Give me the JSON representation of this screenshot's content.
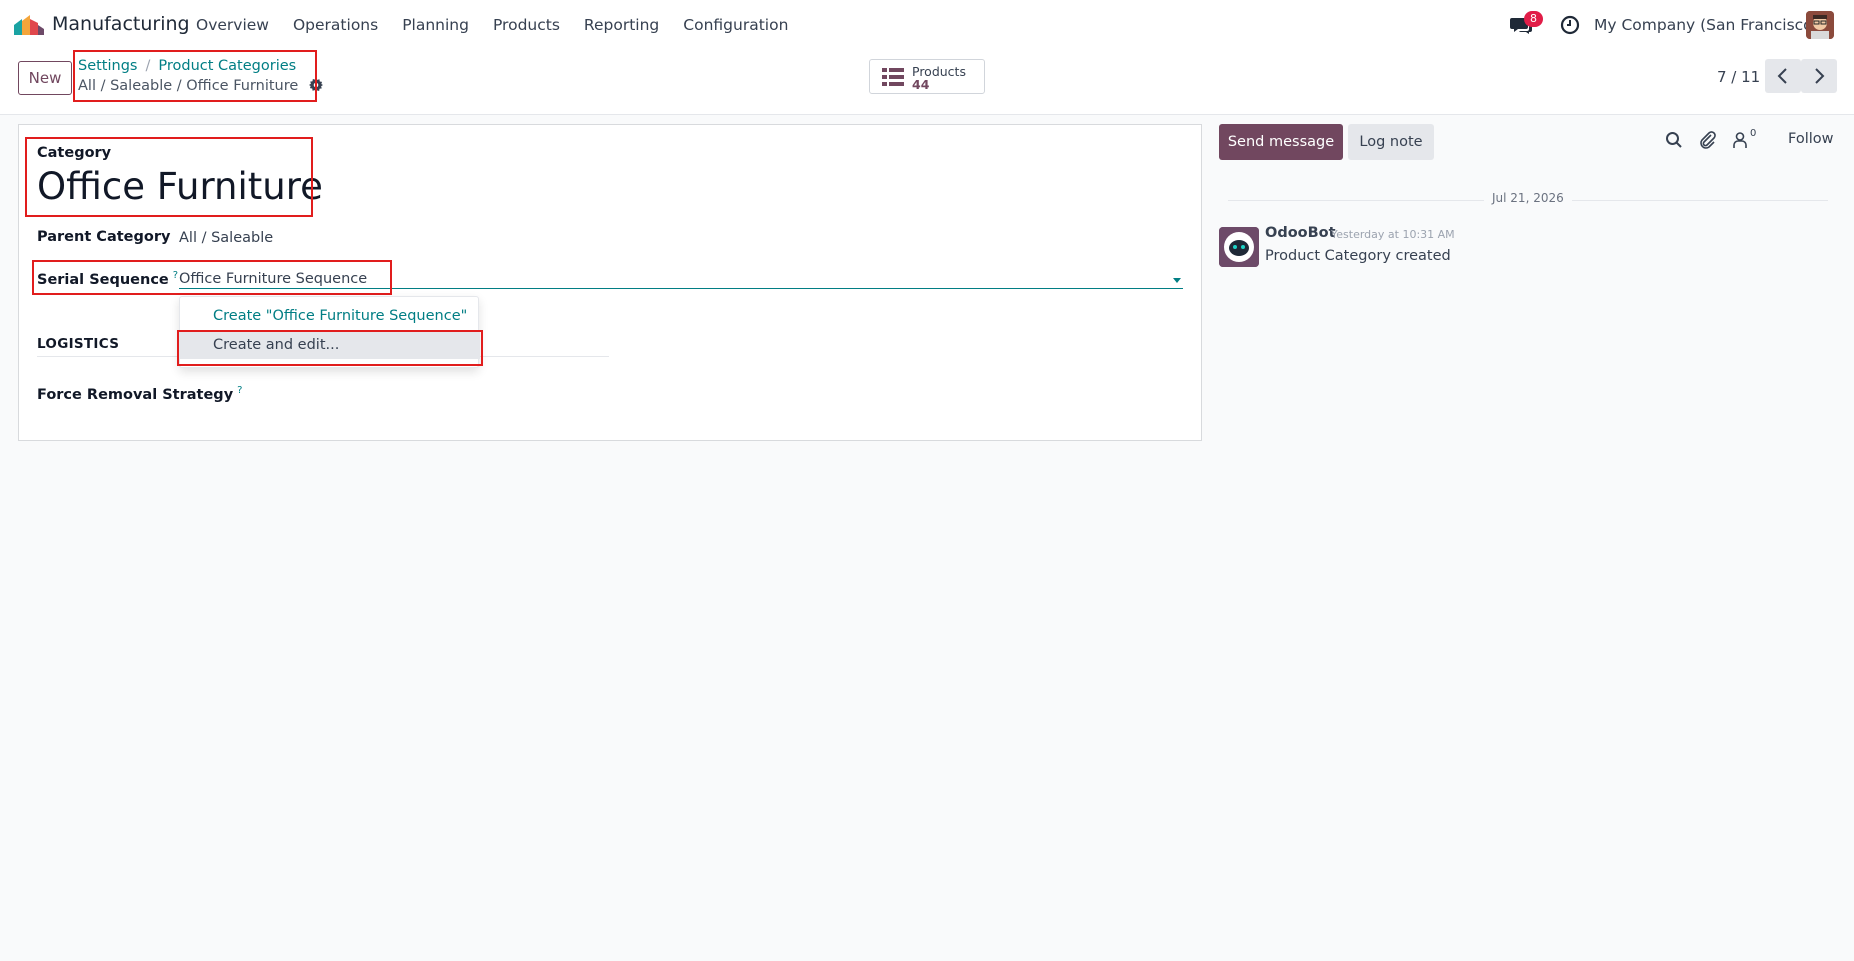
{
  "navbar": {
    "app_name": "Manufacturing",
    "menu": [
      "Overview",
      "Operations",
      "Planning",
      "Products",
      "Reporting",
      "Configuration"
    ],
    "messages_badge": "8",
    "company": "My Company (San Francisco)"
  },
  "control_panel": {
    "new_label": "New",
    "breadcrumb": [
      "Settings",
      "Product Categories"
    ],
    "breadcrumb_sep": "/",
    "record_path": "All / Saleable / Office Furniture",
    "smart_button": {
      "label": "Products",
      "value": "44"
    },
    "pager": "7 / 11"
  },
  "form": {
    "title_label": "Category",
    "title": "Office Furniture",
    "parent_label": "Parent Category",
    "parent_value": "All / Saleable",
    "serial_label": "Serial Sequence",
    "serial_value": "Office Furniture Sequence",
    "help_mark": "?",
    "section_logistics": "LOGISTICS",
    "removal_label": "Force Removal Strategy"
  },
  "dropdown": {
    "create_option": "Create \"Office Furniture Sequence\"",
    "create_edit_option": "Create and edit..."
  },
  "chatter": {
    "send_label": "Send message",
    "log_label": "Log note",
    "followers": "0",
    "follow_label": "Follow",
    "date": "Jul 21, 2026",
    "author": "OdooBot",
    "time": "Yesterday at 10:31 AM",
    "body": "Product Category created"
  },
  "colors": {
    "brand": "#71475f",
    "link": "#017e84",
    "highlight_box": "#e11d1d",
    "badge": "#e11d48"
  }
}
